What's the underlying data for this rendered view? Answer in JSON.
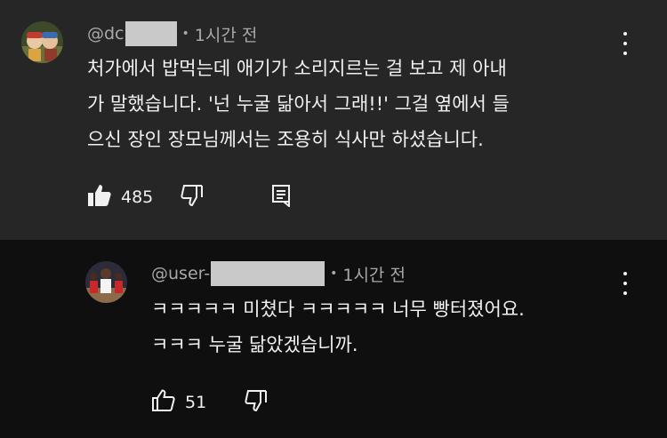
{
  "main_comment": {
    "handle": "@dc",
    "time": "1시간 전",
    "dot": "•",
    "lines": [
      "처가에서 밥먹는데 애기가 소리지르는 걸 보고 제 아내",
      "가 말했습니다. '넌 누굴 닮아서 그래!!' 그걸 옆에서 들",
      "으신 장인 장모님께서는 조용히 식사만 하셨습니다."
    ],
    "like_count": "485",
    "icons": {
      "like": "thumbs-up-filled-icon",
      "dislike": "thumbs-down-icon",
      "reply": "comment-icon",
      "menu": "kebab-menu-icon"
    }
  },
  "reply_comment": {
    "handle": "@user-",
    "time": "1시간 전",
    "dot": "•",
    "lines": [
      "ㅋㅋㅋㅋㅋ 미쳤다 ㅋㅋㅋㅋㅋ 너무 빵터졌어요.",
      "ㅋㅋㅋ 누굴 닮았겠습니까."
    ],
    "like_count": "51",
    "icons": {
      "like": "thumbs-up-outline-icon",
      "dislike": "thumbs-down-icon",
      "menu": "kebab-menu-icon"
    }
  },
  "colors": {
    "main_background": "#262626",
    "reply_background": "#0f0f0f",
    "text": "#f1f1f1",
    "meta_text": "#a8a8a8",
    "redaction": "#c9c9c9"
  }
}
